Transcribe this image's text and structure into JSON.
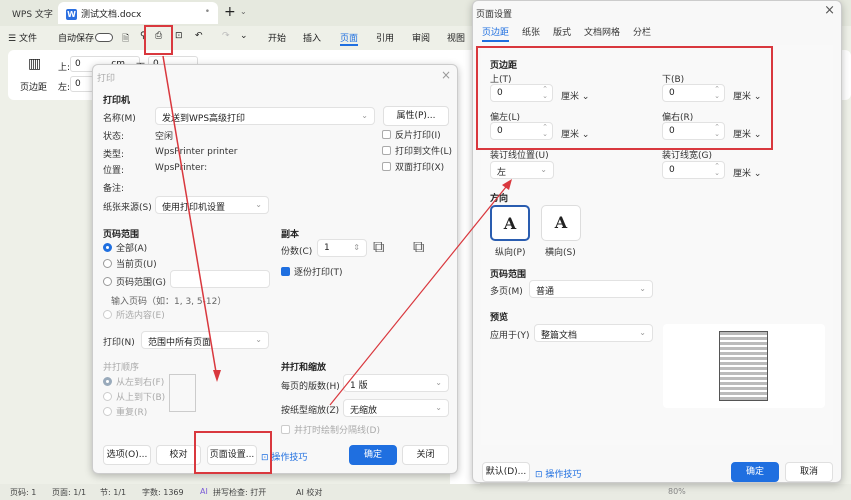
{
  "app": {
    "name": "WPS 文字",
    "doc_tab": "测试文档.docx",
    "doc_icon": "W"
  },
  "toolbar": {
    "file": "文件",
    "autosave": "自动保存",
    "menus": [
      "开始",
      "插入",
      "页面",
      "引用",
      "审阅",
      "视图"
    ],
    "active_menu": "页面"
  },
  "ribbon": {
    "top_label": "上:",
    "top_value": "0",
    "bottom_label": "下:",
    "bottom_value": "0",
    "left_label": "左:",
    "left_value": "0",
    "unit": "cm",
    "margins_btn": "页边距"
  },
  "status": {
    "page": "页码: 1",
    "pages": "页面: 1/1",
    "section": "节: 1/1",
    "words": "字数: 1369",
    "spell": "拼写检查: 打开",
    "ai": "AI 校对",
    "zoom": "80%"
  },
  "print": {
    "title": "打印",
    "printer_head": "打印机",
    "name_label": "名称(M)",
    "name_value": "发送到WPS高级打印",
    "props_btn": "属性(P)...",
    "status_label": "状态:",
    "status_value": "空闲",
    "type_label": "类型:",
    "type_value": "WpsPrinter printer",
    "where_label": "位置:",
    "where_value": "WpsPrinter:",
    "comment_label": "备注:",
    "reverse": "反片打印(I)",
    "to_file": "打印到文件(L)",
    "duplex": "双面打印(X)",
    "source_label": "纸张来源(S)",
    "source_value": "使用打印机设置",
    "range_head": "页码范围",
    "all": "全部(A)",
    "current": "当前页(U)",
    "pages": "页码范围(G)",
    "hint": "输入页码（如：1, 3, 5-12）",
    "selection": "所选内容(E)",
    "copies_head": "副本",
    "copies_label": "份数(C)",
    "copies_value": "1",
    "collate": "逐份打印(T)",
    "print_label": "打印(N)",
    "print_value": "范围中所有页面",
    "order_head": "并打顺序",
    "ltr": "从左到右(F)",
    "ttb": "从上到下(B)",
    "repeat": "重复(R)",
    "scale_head": "并打和缩放",
    "per_page_label": "每页的版数(H)",
    "per_page_value": "1 版",
    "scale_label": "按纸型缩放(Z)",
    "scale_value": "无缩放",
    "draw_lines": "并打时绘制分隔线(D)",
    "options_btn": "选项(O)...",
    "proof_btn": "校对",
    "page_setup_btn": "页面设置...",
    "tips": "操作技巧",
    "ok": "确定",
    "close": "关闭"
  },
  "setup": {
    "title": "页面设置",
    "tabs": [
      "页边距",
      "纸张",
      "版式",
      "文档网格",
      "分栏"
    ],
    "active_tab": "页边距",
    "margins_head": "页边距",
    "top": "上(T)",
    "bottom": "下(B)",
    "left": "偏左(L)",
    "right": "偏右(R)",
    "top_value": "0",
    "bottom_value": "0",
    "left_value": "0",
    "right_value": "0",
    "unit": "厘米",
    "gutter_pos_label": "装订线位置(U)",
    "gutter_pos_value": "左",
    "gutter_label": "装订线宽(G)",
    "gutter_value": "0",
    "orient_head": "方向",
    "portrait": "纵向(P)",
    "landscape": "横向(S)",
    "orientation": "portrait",
    "range_head": "页码范围",
    "multi_label": "多页(M)",
    "multi_value": "普通",
    "preview_head": "预览",
    "apply_label": "应用于(Y)",
    "apply_value": "整篇文档",
    "default_btn": "默认(D)...",
    "tips": "操作技巧",
    "ok": "确定",
    "cancel": "取消"
  },
  "colors": {
    "accent": "#1f6fe0",
    "annotation": "#d9383e"
  }
}
